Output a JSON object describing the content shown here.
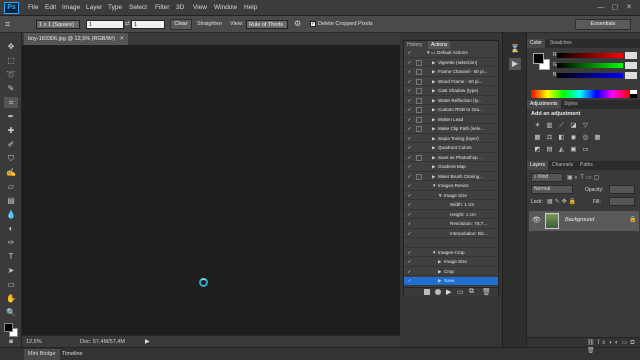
{
  "app": {
    "logo": "Ps",
    "accent": "#31a8ff"
  },
  "menubar": {
    "items": [
      "File",
      "Edit",
      "Image",
      "Layer",
      "Type",
      "Select",
      "Filter",
      "3D",
      "View",
      "Window",
      "Help"
    ],
    "minimize": "—",
    "maximize": "▢",
    "close": "✕"
  },
  "options": {
    "ratio": "1 x 1 (Square)",
    "width": "1",
    "height": "1",
    "clear": "Clear",
    "straighten": "Straighten",
    "view_label": "View:",
    "view_value": "Rule of Thirds",
    "delete_cropped": "Delete Cropped Pixels",
    "workspace": "Essentials"
  },
  "document": {
    "tab_title": "boy-183306.jpg @ 12,5% (RGB/8#)",
    "zoom": "12,5%",
    "doc_size": "Doc: 57,4M/57,4M"
  },
  "actions_panel": {
    "tabs": [
      "History",
      "Actions"
    ],
    "rows": [
      {
        "label": "Default Actions",
        "indent": 0,
        "open": true,
        "folder": true,
        "dlg": false
      },
      {
        "label": "Vignette (selection)",
        "indent": 1,
        "open": false,
        "folder": false,
        "dlg": true
      },
      {
        "label": "Frame Channel - 50 pi...",
        "indent": 1,
        "open": false,
        "folder": false,
        "dlg": true
      },
      {
        "label": "Wood Frame - 50 pi...",
        "indent": 1,
        "open": false,
        "folder": false,
        "dlg": true
      },
      {
        "label": "Cast Shadow (type)",
        "indent": 1,
        "open": false,
        "folder": false,
        "dlg": true
      },
      {
        "label": "Water Reflection (ty...",
        "indent": 1,
        "open": false,
        "folder": false,
        "dlg": true
      },
      {
        "label": "Custom RGB to Gra...",
        "indent": 1,
        "open": false,
        "folder": false,
        "dlg": true
      },
      {
        "label": "Molten Lead",
        "indent": 1,
        "open": false,
        "folder": false,
        "dlg": true
      },
      {
        "label": "Make Clip Path (sele...",
        "indent": 1,
        "open": false,
        "folder": false,
        "dlg": true
      },
      {
        "label": "Sepia Toning (layer)",
        "indent": 1,
        "open": false,
        "folder": false,
        "dlg": false
      },
      {
        "label": "Quadrant Colors",
        "indent": 1,
        "open": false,
        "folder": false,
        "dlg": false
      },
      {
        "label": "Save as Photoshop ...",
        "indent": 1,
        "open": false,
        "folder": false,
        "dlg": true
      },
      {
        "label": "Gradient Map",
        "indent": 1,
        "open": false,
        "folder": false,
        "dlg": false
      },
      {
        "label": "Mixer Brush Cloning...",
        "indent": 1,
        "open": false,
        "folder": false,
        "dlg": true
      },
      {
        "label": "Images-Resize",
        "indent": 1,
        "open": true,
        "folder": false,
        "dlg": false
      },
      {
        "label": "Image Size",
        "indent": 2,
        "open": true,
        "folder": false,
        "dlg": false
      },
      {
        "label": "Width: 1 cm",
        "indent": 3,
        "open": false,
        "folder": false,
        "dlg": false,
        "detail": true
      },
      {
        "label": "Height: 1 cm",
        "indent": 3,
        "open": false,
        "folder": false,
        "dlg": false,
        "detail": true
      },
      {
        "label": "Resolution: 78,7...",
        "indent": 3,
        "open": false,
        "folder": false,
        "dlg": false,
        "detail": true
      },
      {
        "label": "Interpolation: Bic...",
        "indent": 3,
        "open": false,
        "folder": false,
        "dlg": false,
        "detail": true
      },
      {
        "label": "",
        "indent": 0,
        "open": false,
        "folder": false,
        "dlg": false,
        "blank": true
      },
      {
        "label": "Images-Crop",
        "indent": 1,
        "open": true,
        "folder": false,
        "dlg": false
      },
      {
        "label": "Image Size",
        "indent": 2,
        "open": false,
        "folder": false,
        "dlg": false
      },
      {
        "label": "Crop",
        "indent": 2,
        "open": false,
        "folder": false,
        "dlg": false
      },
      {
        "label": "Save",
        "indent": 2,
        "open": false,
        "folder": false,
        "dlg": false,
        "selected": true
      }
    ],
    "footer_icons": [
      "stop-icon",
      "record-icon",
      "play-icon",
      "new-set-icon",
      "new-action-icon",
      "delete-icon"
    ]
  },
  "color_panel": {
    "tabs": [
      "Color",
      "Swatches"
    ],
    "foreground": "#000000",
    "background": "#ffffff"
  },
  "adjustments_panel": {
    "tabs": [
      "Adjustments",
      "Styles"
    ],
    "title": "Add an adjustment"
  },
  "layers_panel": {
    "tabs": [
      "Layers",
      "Channels",
      "Paths"
    ],
    "kind": "Kind",
    "blend": "Normal",
    "opacity_label": "Opacity:",
    "lock_label": "Lock:",
    "fill_label": "Fill:",
    "layer_name": "Background"
  },
  "bottom_tabs": [
    "Mini Bridge",
    "Timeline"
  ]
}
